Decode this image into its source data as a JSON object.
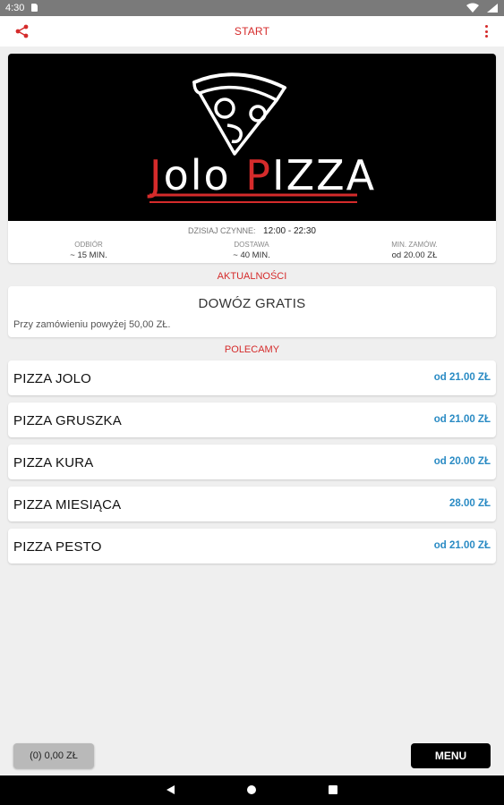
{
  "status_bar": {
    "time": "4:30"
  },
  "app_bar": {
    "title": "START"
  },
  "restaurant": {
    "logo_text_part1": "Jolo",
    "logo_text_part2": "PIZZA",
    "hours_label": "Dzisiaj czynne:",
    "hours_value": "12:00 - 22:30",
    "pickup_label": "Odbiór",
    "pickup_value": "~ 15 MIN.",
    "delivery_label": "Dostawa",
    "delivery_value": "~ 40 MIN.",
    "min_order_label": "Min. zamów.",
    "min_order_value": "od 20.00 ZŁ"
  },
  "news": {
    "section_label": "AKTUALNOŚCI",
    "title": "DOWÓZ GRATIS",
    "body": "Przy zamówieniu powyżej 50,00 ZŁ."
  },
  "recommended": {
    "section_label": "POLECAMY",
    "items": [
      {
        "name": "PIZZA JOLO",
        "price": "od 21.00 ZŁ"
      },
      {
        "name": "PIZZA GRUSZKA",
        "price": "od 21.00 ZŁ"
      },
      {
        "name": "PIZZA KURA",
        "price": "od 20.00 ZŁ"
      },
      {
        "name": "PIZZA MIESIĄCA",
        "price": "28.00 ZŁ"
      },
      {
        "name": "PIZZA PESTO",
        "price": "od 21.00 ZŁ"
      }
    ]
  },
  "bottom": {
    "cart_label": "(0) 0,00 ZŁ",
    "menu_label": "MENU"
  },
  "colors": {
    "accent": "#d52b2b",
    "price": "#2a8bc4",
    "background": "#efefef"
  }
}
